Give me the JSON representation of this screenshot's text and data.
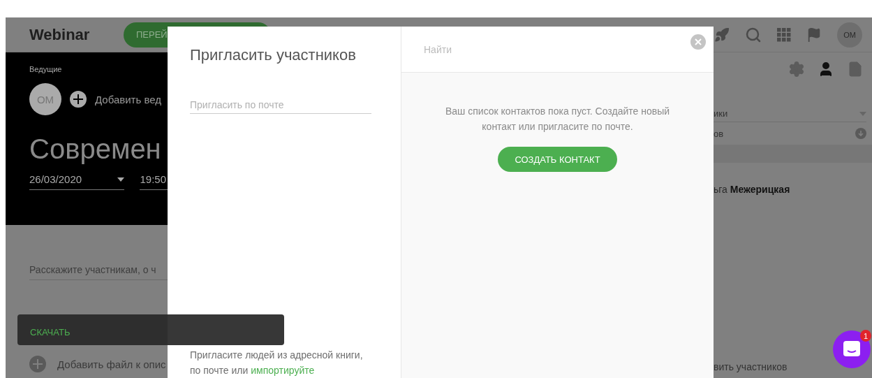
{
  "header": {
    "logo": "Webinar",
    "primary_button": "ПЕРЕЙ",
    "avatar": "ОМ"
  },
  "hosts": {
    "label": "Ведущие",
    "avatar": "ОМ",
    "add_label": "Добавить вед"
  },
  "event": {
    "title": "Современ",
    "date": "26/03/2020",
    "time": "19:50",
    "description_placeholder": "Расскажите участникам, о ч",
    "add_file": "Добавить файл к опис"
  },
  "side_panel": {
    "tabs": [
      {
        "kind": "settings",
        "selected": false
      },
      {
        "kind": "person",
        "selected": true
      },
      {
        "kind": "document",
        "selected": false
      }
    ],
    "dropdown": "ики",
    "row": "ов",
    "name": "ьга **Межерицкая**",
    "footer": "вить участников"
  },
  "invite_dialog": {
    "title": "Пригласить участников",
    "email_placeholder": "Пригласить по почте",
    "hint": "Пригласите людей из адресной книги, по почте или",
    "hint_link": "импортируйте",
    "search_placeholder": "Найти",
    "empty_message": "Ваш список контактов пока пуст. Создайте новый контакт или пригласите по почте.",
    "create_button": "СОЗДАТЬ КОНТАКТ"
  },
  "toast": {
    "action": "СКАЧАТЬ"
  },
  "chat": {
    "badge": "1"
  }
}
